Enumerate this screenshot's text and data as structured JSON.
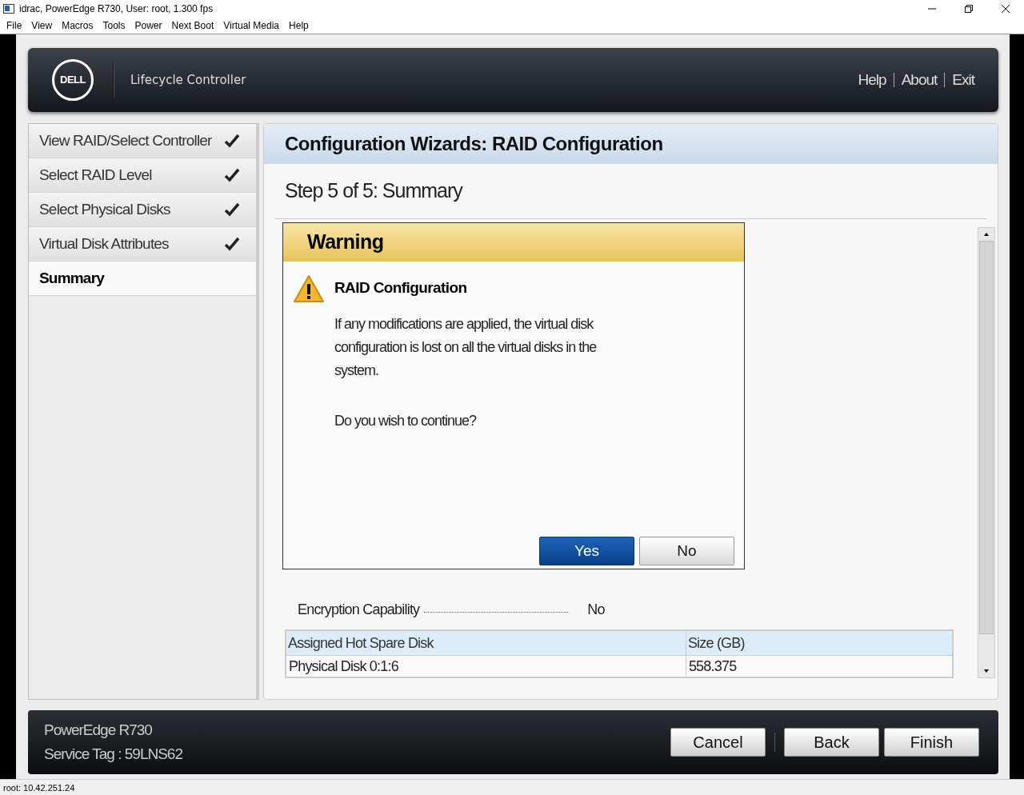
{
  "window": {
    "title": "idrac, PowerEdge R730, User: root, 1.300 fps"
  },
  "menu": [
    "File",
    "View",
    "Macros",
    "Tools",
    "Power",
    "Next Boot",
    "Virtual Media",
    "Help"
  ],
  "header": {
    "logo": "DELL",
    "product": "Lifecycle Controller",
    "links": [
      "Help",
      "About",
      "Exit"
    ]
  },
  "sidebar": {
    "items": [
      {
        "label": "View RAID/Select Controller",
        "completed": true,
        "selected": false
      },
      {
        "label": "Select RAID Level",
        "completed": true,
        "selected": false
      },
      {
        "label": "Select Physical Disks",
        "completed": true,
        "selected": false
      },
      {
        "label": "Virtual Disk Attributes",
        "completed": true,
        "selected": false
      },
      {
        "label": "Summary",
        "completed": false,
        "selected": true
      }
    ]
  },
  "main": {
    "title": "Configuration Wizards: RAID Configuration",
    "step": "Step 5 of 5: Summary",
    "properties": [
      {
        "label": "Encryption Capability",
        "value": "No"
      }
    ],
    "table": {
      "columns": [
        "Assigned Hot Spare Disk",
        "Size (GB)"
      ],
      "rows": [
        [
          "Physical Disk 0:1:6",
          "558.375"
        ]
      ]
    }
  },
  "dialog": {
    "title": "Warning",
    "heading": "RAID Configuration",
    "paragraphs": [
      "If any modifications are applied, the virtual disk configuration is lost on all the virtual disks in the system.",
      "Do you wish to continue?"
    ],
    "buttons": [
      {
        "label": "Yes",
        "kind": "primary"
      },
      {
        "label": "No",
        "kind": "secondary"
      }
    ]
  },
  "footer": {
    "model": "PowerEdge R730",
    "service_tag": "Service Tag : 59LNS62",
    "buttons": [
      "Cancel",
      "Back",
      "Finish"
    ]
  },
  "status_bar": "root: 10.42.251.24"
}
